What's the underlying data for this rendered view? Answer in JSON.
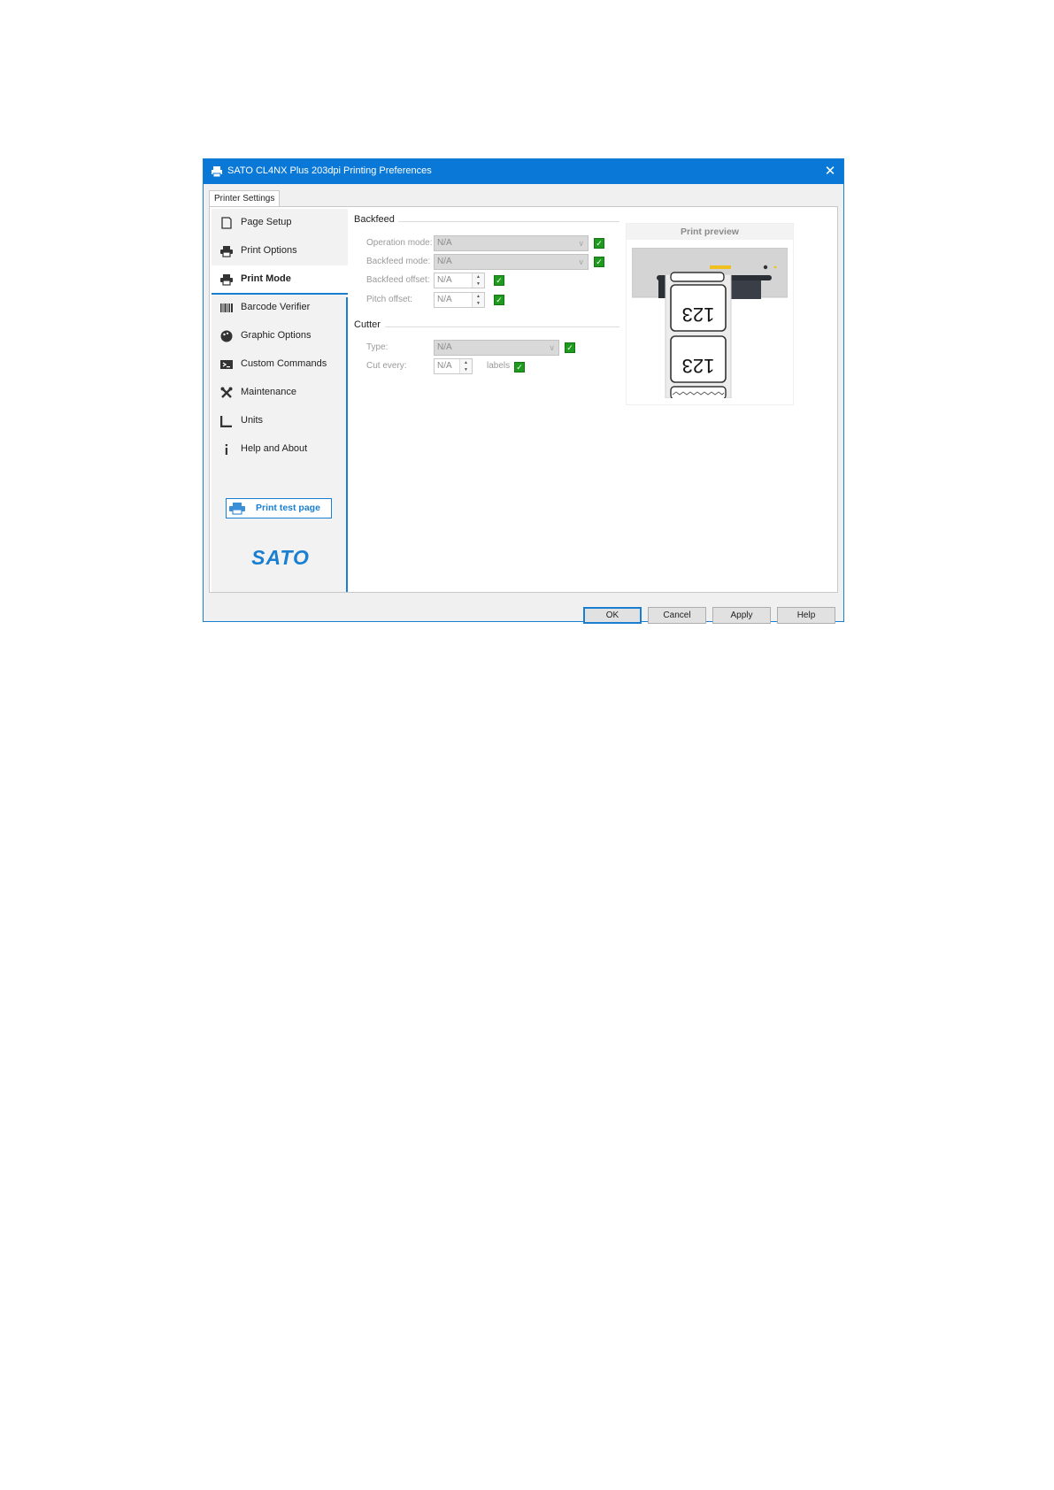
{
  "window": {
    "title": "SATO CL4NX Plus 203dpi Printing Preferences",
    "close_glyph": "✕"
  },
  "tabs": [
    "Printer Settings"
  ],
  "sidebar": {
    "items": [
      {
        "label": "Page Setup",
        "icon": "page-icon"
      },
      {
        "label": "Print Options",
        "icon": "printer-icon"
      },
      {
        "label": "Print Mode",
        "icon": "printer-icon",
        "active": true
      },
      {
        "label": "Barcode Verifier",
        "icon": "barcode-icon"
      },
      {
        "label": "Graphic Options",
        "icon": "palette-icon"
      },
      {
        "label": "Custom Commands",
        "icon": "terminal-icon"
      },
      {
        "label": "Maintenance",
        "icon": "tools-icon"
      },
      {
        "label": "Units",
        "icon": "ruler-icon"
      },
      {
        "label": "Help and About",
        "icon": "info-icon"
      }
    ],
    "test_button": "Print test page",
    "logo_text": "SATO"
  },
  "backfeed": {
    "heading": "Backfeed",
    "operation_mode": {
      "label": "Operation mode:",
      "value": "N/A",
      "checked": true
    },
    "backfeed_mode": {
      "label": "Backfeed mode:",
      "value": "N/A",
      "checked": true
    },
    "backfeed_offset": {
      "label": "Backfeed offset:",
      "value": "N/A",
      "checked": true
    },
    "pitch_offset": {
      "label": "Pitch offset:",
      "value": "N/A",
      "checked": true
    }
  },
  "cutter": {
    "heading": "Cutter",
    "type": {
      "label": "Type:",
      "value": "N/A",
      "checked": true
    },
    "cut_every": {
      "label": "Cut every:",
      "value": "N/A",
      "suffix": "labels",
      "checked": true
    }
  },
  "preview": {
    "title": "Print preview",
    "label_text": "123"
  },
  "buttons": {
    "ok": "OK",
    "cancel": "Cancel",
    "apply": "Apply",
    "help": "Help"
  },
  "colors": {
    "title_bar": "#0a78d7",
    "accent": "#1a7fd1",
    "checkbox": "#1e9b1e",
    "preview_led": "#f0c020"
  }
}
